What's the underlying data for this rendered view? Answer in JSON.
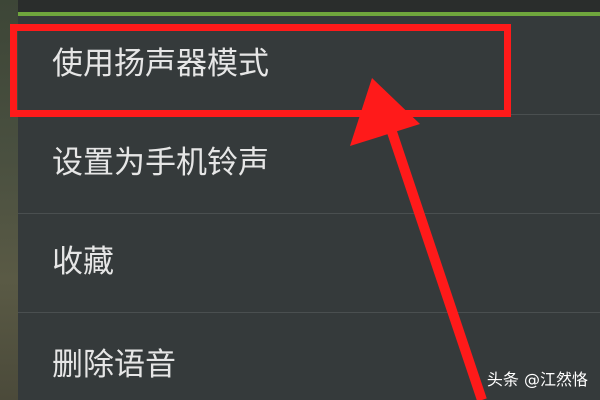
{
  "menu": {
    "items": [
      {
        "label": "使用扬声器模式"
      },
      {
        "label": "设置为手机铃声"
      },
      {
        "label": "收藏"
      },
      {
        "label": "删除语音"
      }
    ]
  },
  "watermark": {
    "text": "头条 @江然恪"
  },
  "colors": {
    "menu_bg": "#353a3b",
    "accent": "#6fa63d",
    "annotation": "#ff1a1a",
    "text": "#e6e6e6"
  }
}
